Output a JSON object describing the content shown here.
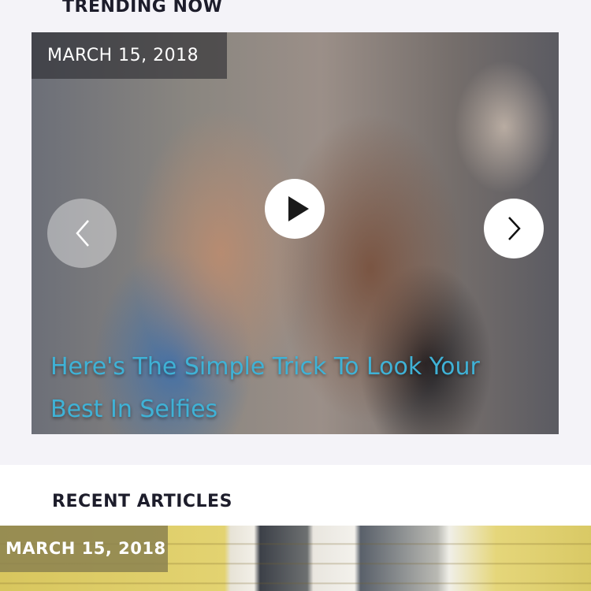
{
  "trending": {
    "heading": "TRENDING NOW",
    "date": "MARCH 15, 2018",
    "title": "Here's The Simple Trick To Look Your Best In Selfies",
    "title_color": "#3fb2d6",
    "play_icon": "play-icon",
    "prev_icon": "chevron-left-icon",
    "next_icon": "chevron-right-icon"
  },
  "recent": {
    "heading": "RECENT ARTICLES",
    "date": "MARCH 15, 2018"
  }
}
